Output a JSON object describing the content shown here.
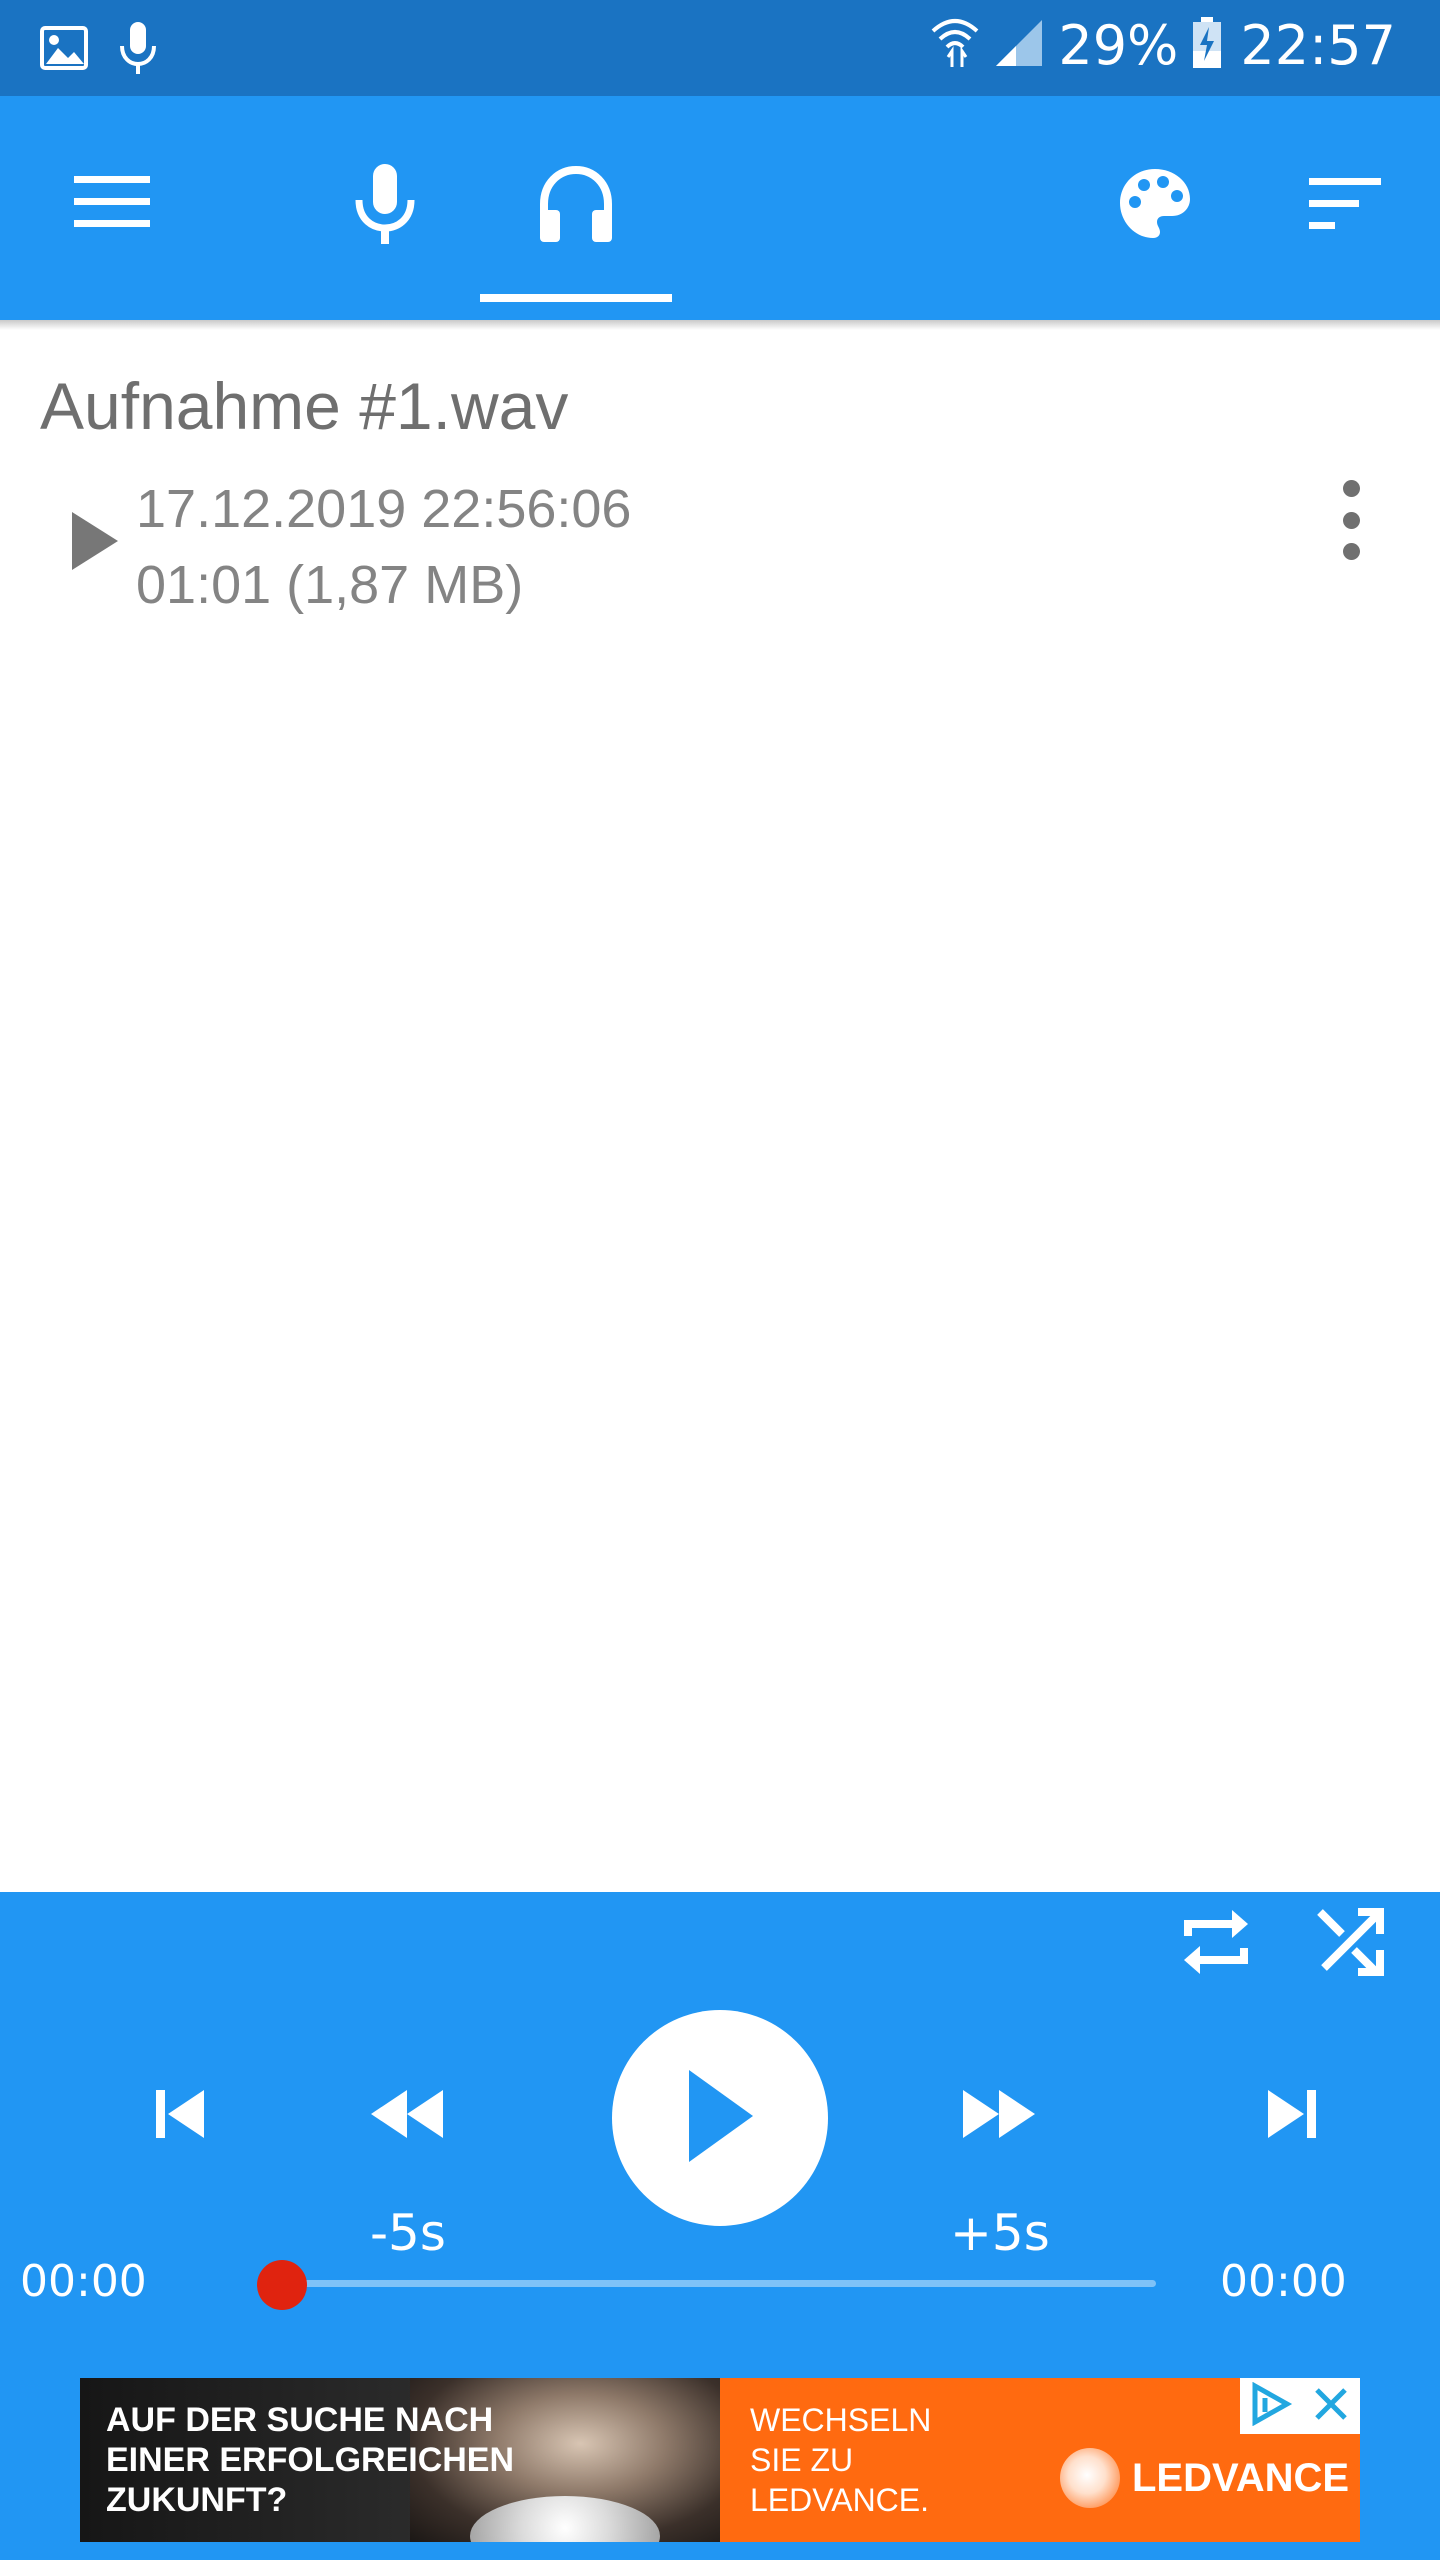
{
  "status_bar": {
    "battery": "29%",
    "time": "22:57",
    "icons": [
      "image-icon",
      "mic-icon",
      "wifi-icon",
      "signal-icon",
      "battery-charging-icon"
    ]
  },
  "toolbar": {
    "icons": [
      "menu-icon",
      "mic-icon",
      "headphones-icon",
      "palette-icon",
      "sort-icon"
    ],
    "active_tab": "headphones",
    "accent_color": "#2196f3"
  },
  "recordings": [
    {
      "title": "Aufnahme #1.wav",
      "date": "17.12.2019 22:56:06",
      "meta": "01:01 (1,87 MB)"
    }
  ],
  "player": {
    "skip_back_label": "-5s",
    "skip_forward_label": "+5s",
    "current_time": "00:00",
    "total_time": "00:00",
    "progress": 0.0,
    "seek_thumb_color": "#e0230f"
  },
  "ad": {
    "headline": "AUF DER SUCHE NACH\n EINER ERFOLGREICHEN\nZUKUNFT?",
    "subline": "WECHSELN\nSIE ZU\nLEDVANCE.",
    "brand": "LEDVANCE",
    "color": "#ff6a10"
  }
}
